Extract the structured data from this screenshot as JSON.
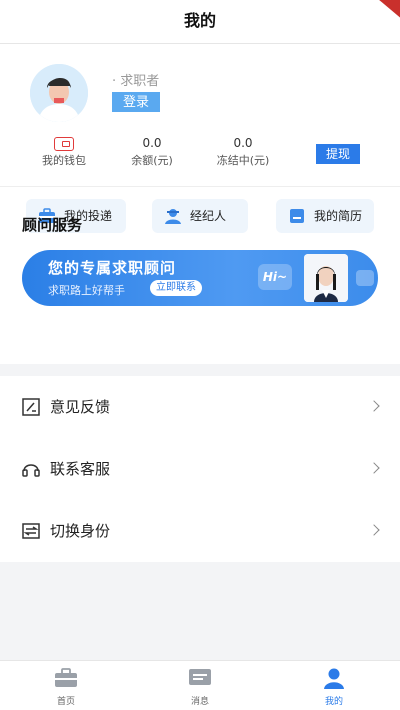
{
  "header": {
    "title": "我的"
  },
  "profile": {
    "role": "· 求职者",
    "login_label": "登录"
  },
  "stats": {
    "wallet_label": "我的钱包",
    "balance_value": "0.0",
    "balance_label": "余额(元)",
    "frozen_value": "0.0",
    "frozen_label": "冻结中(元)",
    "withdraw_label": "提现"
  },
  "quick_actions": [
    {
      "label": "我的投递",
      "icon": "briefcase-icon"
    },
    {
      "label": "经纪人",
      "icon": "agent-icon"
    },
    {
      "label": "我的简历",
      "icon": "resume-icon"
    }
  ],
  "advisor": {
    "section_title": "顾问服务",
    "banner_title": "您的专属求职顾问",
    "banner_subtitle": "求职路上好帮手",
    "contact_label": "立即联系",
    "hi_text": "Hi~"
  },
  "menu": [
    {
      "label": "意见反馈",
      "icon": "feedback-icon"
    },
    {
      "label": "联系客服",
      "icon": "headset-icon"
    },
    {
      "label": "切换身份",
      "icon": "switch-identity-icon"
    }
  ],
  "bottom_nav": [
    {
      "label": "首页",
      "icon": "home-briefcase-icon"
    },
    {
      "label": "消息",
      "icon": "message-icon"
    },
    {
      "label": "我的",
      "icon": "profile-icon",
      "active": true
    }
  ],
  "colors": {
    "accent": "#2b7be8",
    "login": "#5aa9f0",
    "wallet": "#e03b3b"
  }
}
